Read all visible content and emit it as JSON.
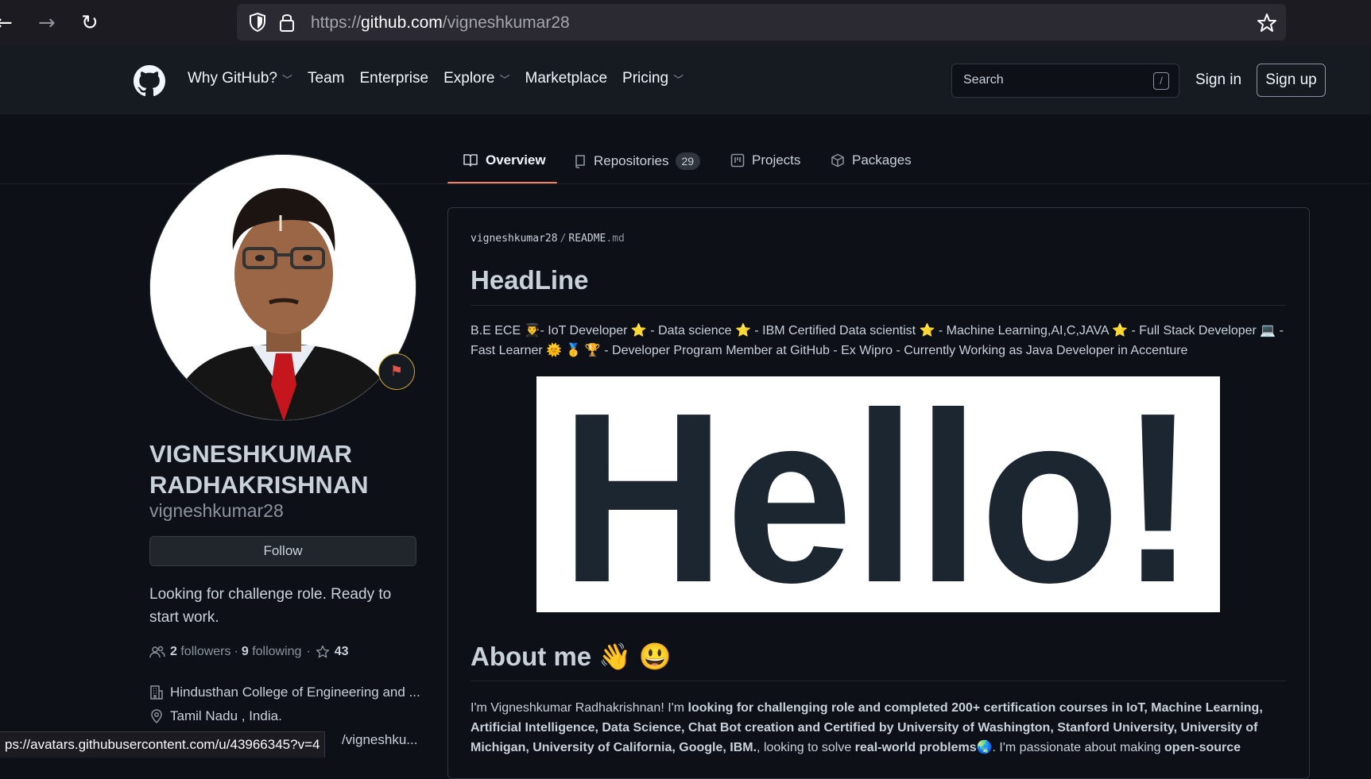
{
  "browser": {
    "url_prefix": "https://",
    "url_domain": "github.com",
    "url_path": "/vigneshkumar28",
    "status_url": "ps://avatars.githubusercontent.com/u/43966345?v=4"
  },
  "header": {
    "nav": [
      {
        "label": "Why GitHub?",
        "caret": true
      },
      {
        "label": "Team",
        "caret": false
      },
      {
        "label": "Enterprise",
        "caret": false
      },
      {
        "label": "Explore",
        "caret": true
      },
      {
        "label": "Marketplace",
        "caret": false
      },
      {
        "label": "Pricing",
        "caret": true
      }
    ],
    "search_placeholder": "Search",
    "search_shortcut": "/",
    "sign_in": "Sign in",
    "sign_up": "Sign up"
  },
  "tabs": {
    "overview": "Overview",
    "repositories": "Repositories",
    "repositories_count": "29",
    "projects": "Projects",
    "packages": "Packages"
  },
  "profile": {
    "full_name": "VIGNESHKUMAR RADHAKRISHNAN",
    "login": "vigneshkumar28",
    "follow_label": "Follow",
    "bio": "Looking for challenge role. Ready to start work.",
    "followers_count": "2",
    "followers_label": "followers",
    "following_count": "9",
    "following_label": "following",
    "stars_count": "43",
    "organization": "Hindusthan College of Engineering and ...",
    "location": "Tamil Nadu , India.",
    "link_partial": "/vigneshku..."
  },
  "readme": {
    "owner": "vigneshkumar28",
    "file_name": "README",
    "file_ext": ".md",
    "headline_title": "HeadLine",
    "headline_text": "B.E ECE 👨‍🎓- IoT Developer ⭐ - Data science ⭐ - IBM Certified Data scientist ⭐ - Machine Learning,AI,C,JAVA ⭐ - Full Stack Developer 💻 - Fast Learner 🌞 🥇 🏆 - Developer Program Member at GitHub - Ex Wipro - Currently Working as Java Developer in Accenture",
    "hello_image_text": "Hello!",
    "about_title": "About me 👋 😃",
    "about_intro": "I'm Vigneshkumar Radhakrishnan! I'm ",
    "about_bold1": "looking for challenging role and completed 200+ certification courses in IoT, Machine Learning, Artificial Intelligence, Data Science, Chat Bot creation and Certified by University of Washington, Stanford University, University of Michigan, University of California, Google, IBM.",
    "about_mid": ", looking to solve ",
    "about_bold2": "real-world problems",
    "about_mid2": "🌏. I'm passionate about making ",
    "about_bold3": "open-source"
  },
  "colors": {
    "background": "#0d1117",
    "header_bg": "#161b22",
    "tab_underline": "#f78166",
    "text": "#c9d1d9",
    "muted": "#8b949e"
  }
}
